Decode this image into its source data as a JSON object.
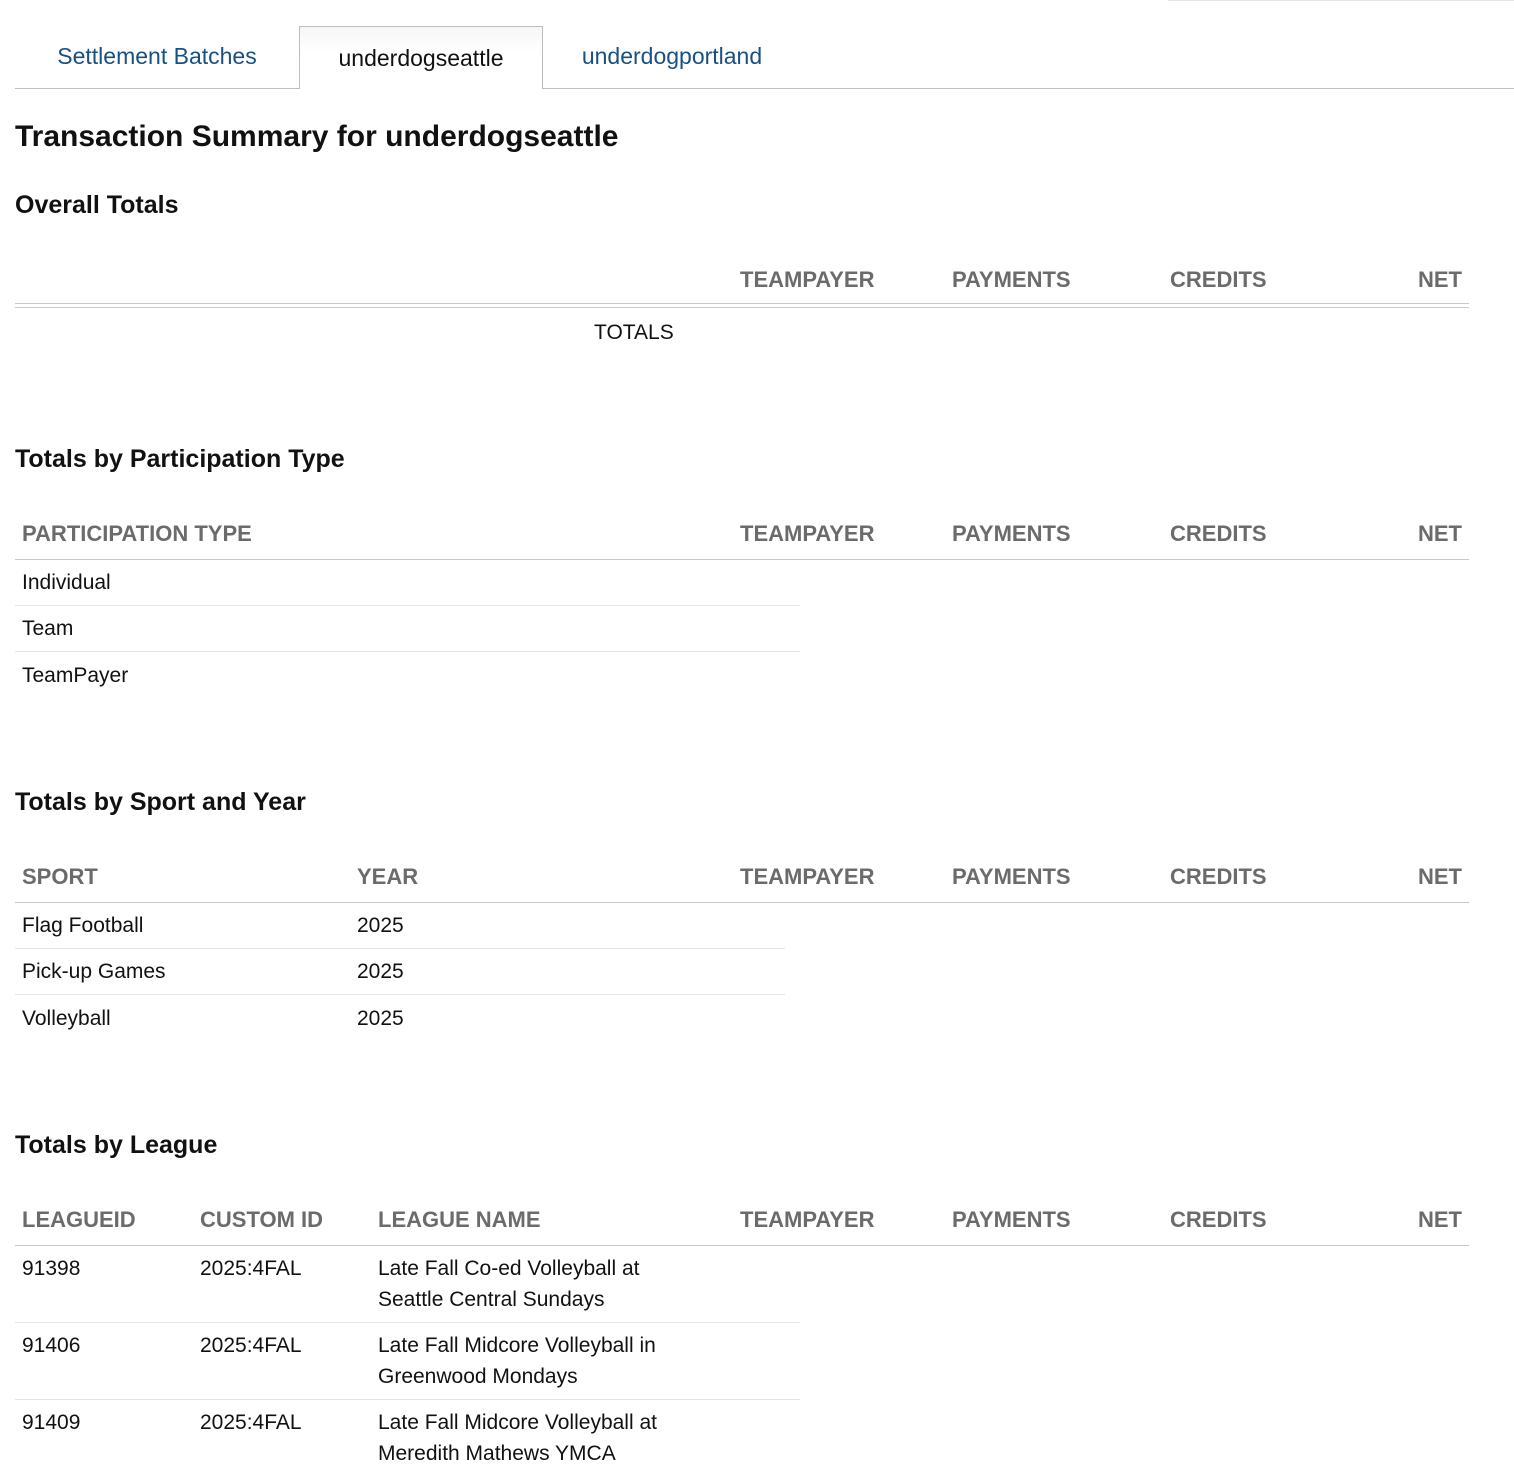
{
  "tabs": [
    {
      "label": "Settlement Batches"
    },
    {
      "label": "underdogseattle"
    },
    {
      "label": "underdogportland"
    }
  ],
  "page_title": "Transaction Summary for underdogseattle",
  "overall": {
    "heading": "Overall Totals",
    "columns": [
      "TEAMPAYER",
      "PAYMENTS",
      "CREDITS",
      "NET"
    ],
    "totals_label": "TOTALS"
  },
  "participation": {
    "heading": "Totals by Participation Type",
    "columns": [
      "PARTICIPATION TYPE",
      "TEAMPAYER",
      "PAYMENTS",
      "CREDITS",
      "NET"
    ],
    "rows": [
      {
        "type": "Individual"
      },
      {
        "type": "Team"
      },
      {
        "type": "TeamPayer"
      }
    ]
  },
  "sport_year": {
    "heading": "Totals by Sport and Year",
    "columns": [
      "SPORT",
      "YEAR",
      "TEAMPAYER",
      "PAYMENTS",
      "CREDITS",
      "NET"
    ],
    "rows": [
      {
        "sport": "Flag Football",
        "year": "2025"
      },
      {
        "sport": "Pick-up Games",
        "year": "2025"
      },
      {
        "sport": "Volleyball",
        "year": "2025"
      }
    ]
  },
  "league": {
    "heading": "Totals by League",
    "columns": [
      "LEAGUEID",
      "CUSTOM ID",
      "LEAGUE NAME",
      "TEAMPAYER",
      "PAYMENTS",
      "CREDITS",
      "NET"
    ],
    "rows": [
      {
        "leagueid": "91398",
        "custom_id": "2025:4FAL",
        "name_line1": "Late Fall Co-ed Volleyball at",
        "name_line2": "Seattle Central Sundays"
      },
      {
        "leagueid": "91406",
        "custom_id": "2025:4FAL",
        "name_line1": "Late Fall Midcore Volleyball in",
        "name_line2": "Greenwood Mondays"
      },
      {
        "leagueid": "91409",
        "custom_id": "2025:4FAL",
        "name_line1": "Late Fall Midcore Volleyball at",
        "name_line2": "Meredith Mathews YMCA"
      }
    ]
  }
}
